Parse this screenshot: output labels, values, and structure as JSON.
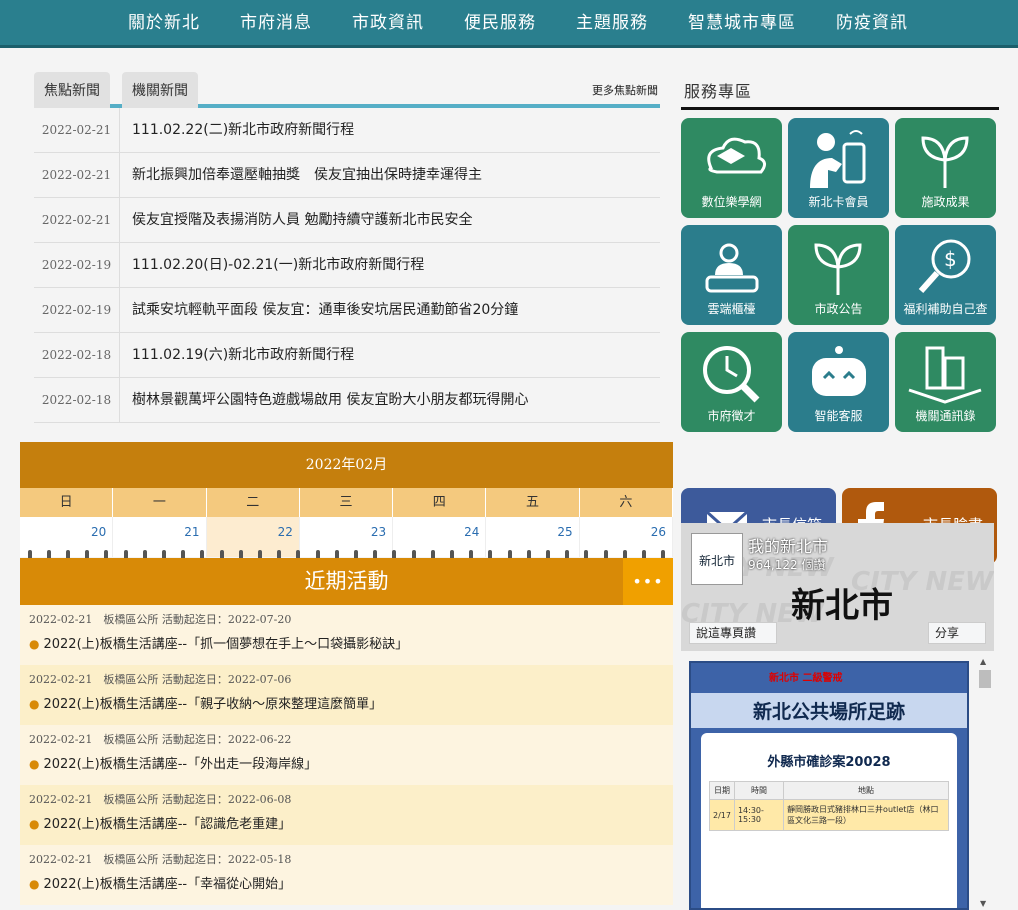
{
  "nav": [
    "關於新北",
    "市府消息",
    "市政資訊",
    "便民服務",
    "主題服務",
    "智慧城市專區",
    "防疫資訊"
  ],
  "news": {
    "tabs": [
      "焦點新聞",
      "機關新聞"
    ],
    "more": "更多焦點新聞",
    "items": [
      {
        "date": "2022-02-21",
        "title": "111.02.22(二)新北市政府新聞行程"
      },
      {
        "date": "2022-02-21",
        "title": "新北振興加倍奉還壓軸抽獎　侯友宜抽出保時捷幸運得主"
      },
      {
        "date": "2022-02-21",
        "title": "侯友宜授階及表揚消防人員 勉勵持續守護新北市民安全"
      },
      {
        "date": "2022-02-19",
        "title": "111.02.20(日)-02.21(一)新北市政府新聞行程"
      },
      {
        "date": "2022-02-19",
        "title": "試乘安坑輕軌平面段 侯友宜：通車後安坑居民通勤節省20分鐘"
      },
      {
        "date": "2022-02-18",
        "title": "111.02.19(六)新北市政府新聞行程"
      },
      {
        "date": "2022-02-18",
        "title": "樹林景觀萬坪公園特色遊戲場啟用 侯友宜盼大小朋友都玩得開心"
      }
    ]
  },
  "calendar": {
    "title": "2022年02月",
    "weekdays": [
      "日",
      "一",
      "二",
      "三",
      "四",
      "五",
      "六"
    ],
    "days": [
      "20",
      "21",
      "22",
      "23",
      "24",
      "25",
      "26"
    ]
  },
  "events": {
    "title": "近期活動",
    "dots": "•••",
    "items": [
      {
        "meta": "2022-02-21　板橋區公所 活動起迄日：2022-07-20",
        "title": "2022(上)板橋生活講座--「抓一個夢想在手上～口袋攝影秘訣」"
      },
      {
        "meta": "2022-02-21　板橋區公所 活動起迄日：2022-07-06",
        "title": "2022(上)板橋生活講座--「親子收納～原來整理這麼簡單」"
      },
      {
        "meta": "2022-02-21　板橋區公所 活動起迄日：2022-06-22",
        "title": "2022(上)板橋生活講座--「外出走一段海岸線」"
      },
      {
        "meta": "2022-02-21　板橋區公所 活動起迄日：2022-06-08",
        "title": "2022(上)板橋生活講座--「認識危老重建」"
      },
      {
        "meta": "2022-02-21　板橋區公所 活動起迄日：2022-05-18",
        "title": "2022(上)板橋生活講座--「幸福從心開始」"
      }
    ]
  },
  "services": {
    "title": "服務專區",
    "tiles": [
      "數位樂學網",
      "新北卡會員",
      "施政成果",
      "雲端櫃檯",
      "市政公告",
      "福利補助自己查",
      "市府徵才",
      "智能客服",
      "機關通訊錄"
    ],
    "mayor_mail": "市長信箱",
    "mayor_fb": "市長臉書"
  },
  "facebook": {
    "avatar_text": "新北市",
    "page_name": "我的新北市",
    "followers": "964,122 個讚",
    "logo": "新北市",
    "like_btn": "說這專頁讚",
    "share_btn": "分享",
    "bg_words": "CITY NEW"
  },
  "poster": {
    "tag": "新北市 二級警戒",
    "title": "新北公共場所足跡",
    "case": "外縣市確診案20028",
    "headers": [
      "日期",
      "時間",
      "地點"
    ],
    "row": [
      "2/17",
      "14:30-15:30",
      "靜岡勝政日式豬排林口三井outlet店（林口區文化三路一段）"
    ]
  },
  "colors": {
    "nav": "#2a7f8e",
    "green_tile": "#2f8a62",
    "teal_tile": "#2b7d8c",
    "calendar": "#c57f0d",
    "events": "#d88a07"
  }
}
